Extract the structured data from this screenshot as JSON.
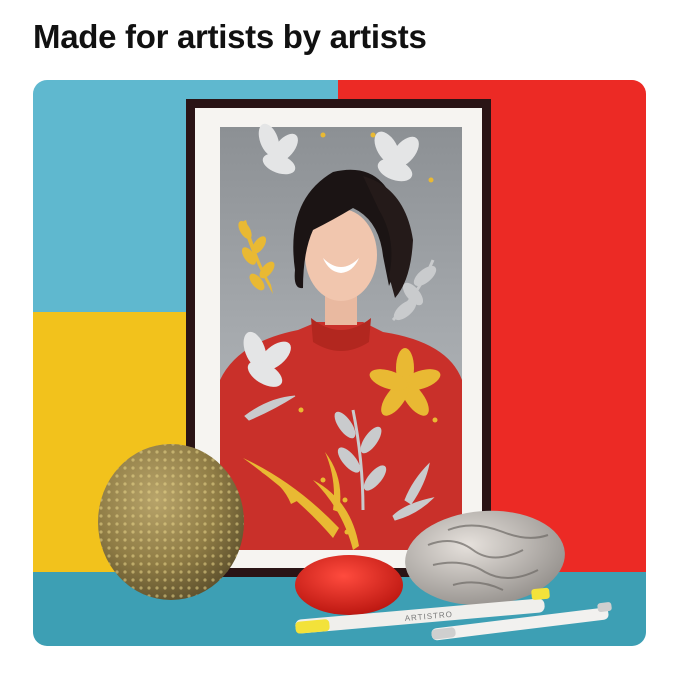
{
  "headline": "Made for artists by artists",
  "colors": {
    "background": "#ffffff",
    "headline": "#111111",
    "wall_blue": "#5fb8cf",
    "wall_red": "#ec2a25",
    "wall_yellow": "#f2c21c",
    "table": "#3d9fb4",
    "frame": "#2a1416",
    "sweater": "#c9302a",
    "gold": "#e9b933",
    "silver": "#c9cbcd"
  },
  "products": {
    "marker_brand": "ARTISTRO"
  },
  "icons": [
    "decorative-flower-icon",
    "decorative-leaf-icon",
    "decorative-dot-icon"
  ]
}
